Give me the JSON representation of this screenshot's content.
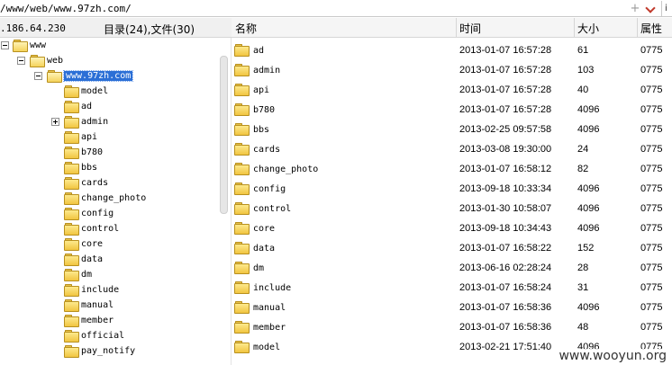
{
  "address": {
    "path": "/www/web/www.97zh.com/",
    "plus": "+",
    "trunc": "i"
  },
  "info": {
    "ip": ".186.64.230",
    "count": "目录(24),文件(30)"
  },
  "columns": {
    "name": "名称",
    "time": "时间",
    "size": "大小",
    "attr": "属性"
  },
  "tree": {
    "root": "www",
    "web": "web",
    "site": "www.97zh.com",
    "children": [
      "model",
      "ad",
      "admin",
      "api",
      "b780",
      "bbs",
      "cards",
      "change_photo",
      "config",
      "control",
      "core",
      "data",
      "dm",
      "include",
      "manual",
      "member",
      "official",
      "pay_notify"
    ]
  },
  "files": [
    {
      "name": "ad",
      "time": "2013-01-07 16:57:28",
      "size": "61",
      "attr": "0775"
    },
    {
      "name": "admin",
      "time": "2013-01-07 16:57:28",
      "size": "103",
      "attr": "0775"
    },
    {
      "name": "api",
      "time": "2013-01-07 16:57:28",
      "size": "40",
      "attr": "0775"
    },
    {
      "name": "b780",
      "time": "2013-01-07 16:57:28",
      "size": "4096",
      "attr": "0775"
    },
    {
      "name": "bbs",
      "time": "2013-02-25 09:57:58",
      "size": "4096",
      "attr": "0775"
    },
    {
      "name": "cards",
      "time": "2013-03-08 19:30:00",
      "size": "24",
      "attr": "0775"
    },
    {
      "name": "change_photo",
      "time": "2013-01-07 16:58:12",
      "size": "82",
      "attr": "0775"
    },
    {
      "name": "config",
      "time": "2013-09-18 10:33:34",
      "size": "4096",
      "attr": "0775"
    },
    {
      "name": "control",
      "time": "2013-01-30 10:58:07",
      "size": "4096",
      "attr": "0775"
    },
    {
      "name": "core",
      "time": "2013-09-18 10:34:43",
      "size": "4096",
      "attr": "0775"
    },
    {
      "name": "data",
      "time": "2013-01-07 16:58:22",
      "size": "152",
      "attr": "0775"
    },
    {
      "name": "dm",
      "time": "2013-06-16 02:28:24",
      "size": "28",
      "attr": "0775"
    },
    {
      "name": "include",
      "time": "2013-01-07 16:58:24",
      "size": "31",
      "attr": "0775"
    },
    {
      "name": "manual",
      "time": "2013-01-07 16:58:36",
      "size": "4096",
      "attr": "0775"
    },
    {
      "name": "member",
      "time": "2013-01-07 16:58:36",
      "size": "48",
      "attr": "0775"
    },
    {
      "name": "model",
      "time": "2013-02-21 17:51:40",
      "size": "4096",
      "attr": "0775"
    }
  ],
  "watermark": "www.wooyun.org"
}
